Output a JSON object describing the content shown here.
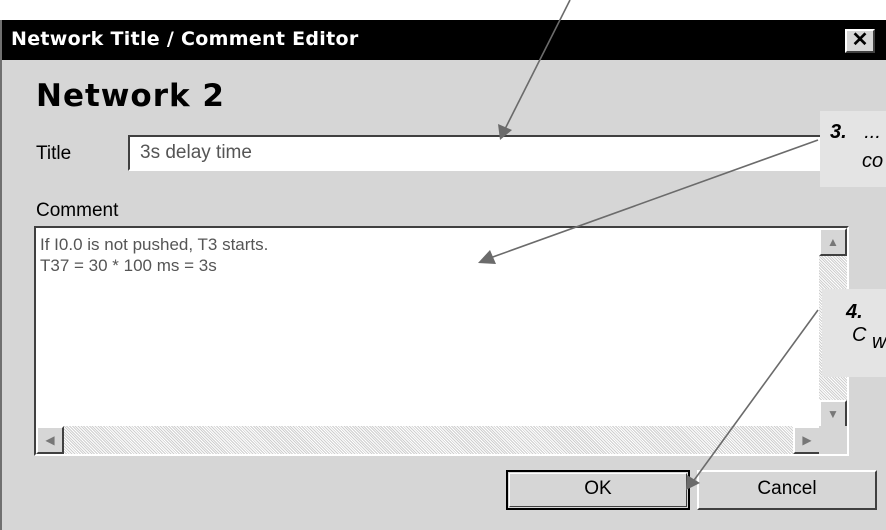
{
  "window": {
    "title": "Network Title / Comment Editor",
    "close_glyph": "✕"
  },
  "network_heading": "Network 2",
  "title_field": {
    "label": "Title",
    "value": "3s delay time"
  },
  "comment_field": {
    "label": "Comment",
    "text": "If I0.0 is not pushed, T3 starts.\nT37 = 30 * 100 ms = 3s"
  },
  "scroll_glyphs": {
    "up": "▲",
    "down": "▼",
    "left": "◀",
    "right": "▶"
  },
  "buttons": {
    "ok_label": "OK",
    "cancel_label": "Cancel"
  },
  "callouts": [
    {
      "number": "3.",
      "line1": "...",
      "line2": "co"
    },
    {
      "number": "4.",
      "line1": "C",
      "line2": "w"
    }
  ]
}
